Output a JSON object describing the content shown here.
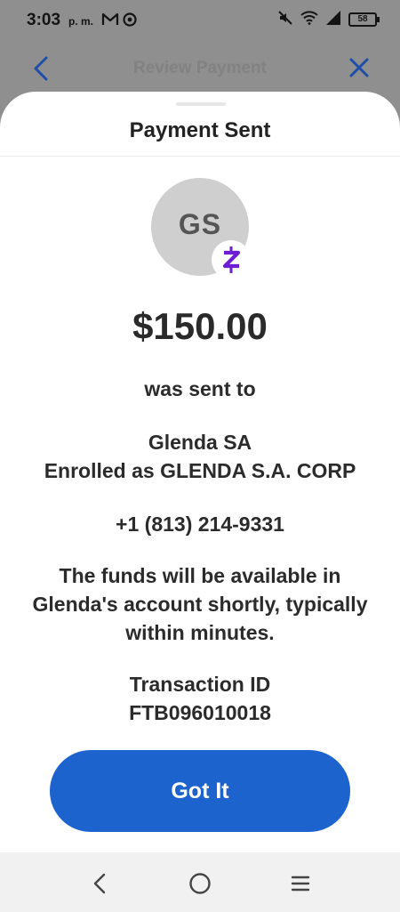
{
  "status_bar": {
    "time": "3:03",
    "ampm": "p. m.",
    "battery": "58",
    "icons": [
      "gmail-icon",
      "chrome-icon",
      "mute-icon",
      "wifi-icon",
      "signal-icon",
      "battery-icon"
    ]
  },
  "app_bar": {
    "title": "Review Payment",
    "back_icon": "back-arrow-icon",
    "close_icon": "close-icon"
  },
  "sheet": {
    "title": "Payment Sent",
    "avatar_initials": "GS",
    "badge_icon": "zelle-icon",
    "amount": "$150.00",
    "sent_to_label": "was sent to",
    "recipient_name": "Glenda SA",
    "enrolled_as": "Enrolled as GLENDA S.A. CORP",
    "phone": "+1 (813) 214-9331",
    "funds_line_1": "The funds will be available in",
    "funds_line_2": "Glenda's account shortly, typically",
    "funds_line_3": "within minutes.",
    "transaction_label": "Transaction ID",
    "transaction_id": "FTB096010018",
    "button_label": "Got It"
  },
  "nav_bar": {
    "icons": [
      "back-icon",
      "home-icon",
      "menu-icon"
    ]
  },
  "colors": {
    "accent": "#1d63cd",
    "zelle_purple": "#6d1ed4",
    "overlay": "#8f8f8f",
    "app_bar_icon": "#1d4fa8"
  }
}
